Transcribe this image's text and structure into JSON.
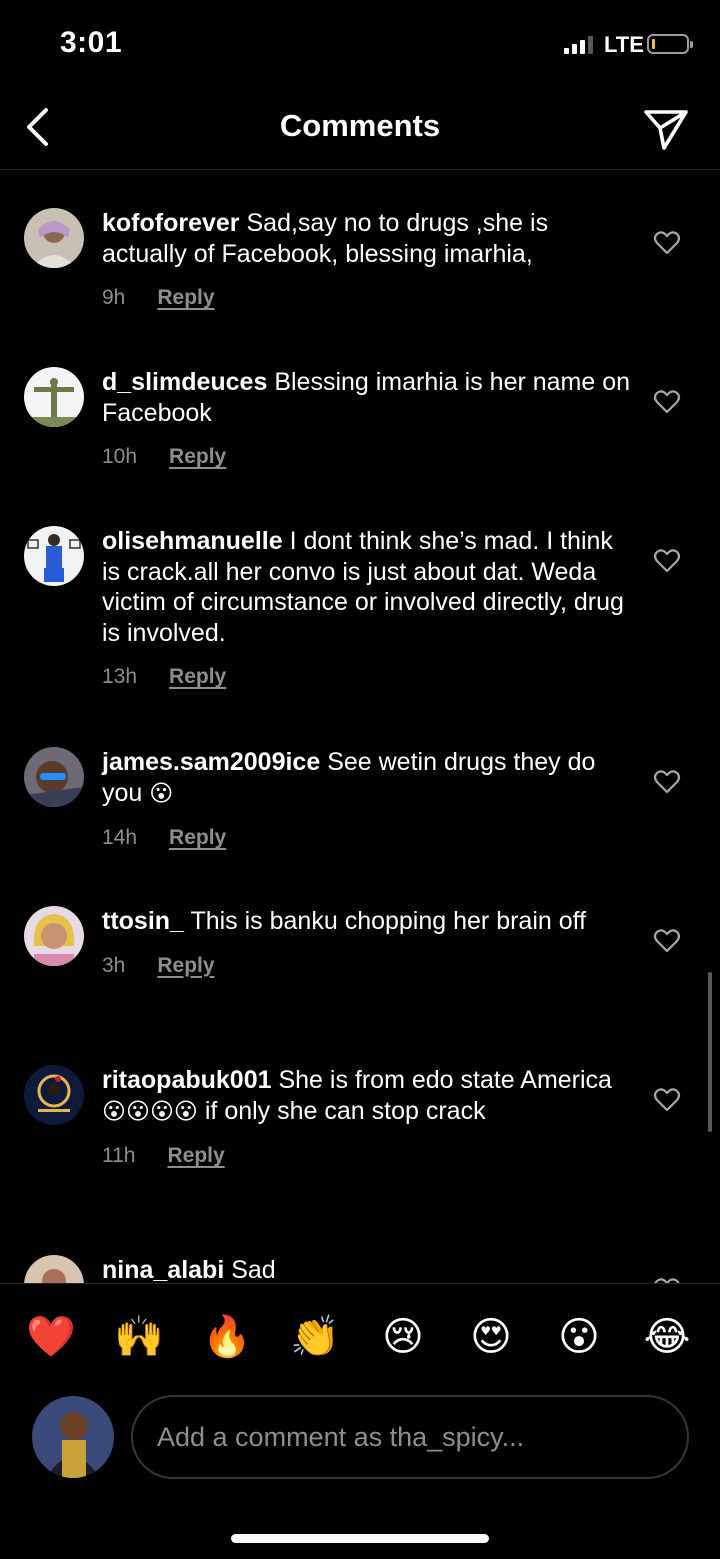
{
  "status_bar": {
    "time": "3:01",
    "network": "LTE",
    "battery_level": 0.1
  },
  "header": {
    "title": "Comments",
    "back_icon": "chevron-left-icon",
    "send_icon": "paper-plane-icon"
  },
  "comments": [
    {
      "username": "kofoforever",
      "text": "Sad,say no to drugs ,she is actually of Facebook, blessing imarhia,",
      "emojis": "",
      "time": "9h",
      "reply": "Reply"
    },
    {
      "username": "d_slimdeuces",
      "text": "Blessing imarhia is her name on Facebook",
      "emojis": "",
      "time": "10h",
      "reply": "Reply"
    },
    {
      "username": "olisehmanuelle",
      "text": "I dont think she’s mad. I think is crack.all her convo is just about dat. Weda victim of circumstance or involved directly, drug is involved.",
      "emojis": "",
      "time": "13h",
      "reply": "Reply"
    },
    {
      "username": "james.sam2009ice",
      "text": "See wetin drugs they do you",
      "emojis": "😮",
      "time": "14h",
      "reply": "Reply"
    },
    {
      "username": "ttosin_",
      "text": "This is banku chopping her brain off",
      "emojis": "",
      "time": "3h",
      "reply": "Reply"
    },
    {
      "username": "ritaopabuk001",
      "text": "She is from edo state America",
      "emojis": "😮😮😮😮",
      "text_after": "if only she can stop crack",
      "time": "11h",
      "reply": "Reply"
    },
    {
      "username": "nina_alabi",
      "text": "Sad",
      "emojis": "",
      "time": "",
      "reply": ""
    }
  ],
  "reactions": [
    "❤️",
    "🙌",
    "🔥",
    "👏",
    "😢",
    "😍",
    "😮",
    "😂"
  ],
  "composer": {
    "placeholder": "Add a comment as tha_spicy..."
  },
  "colors": {
    "background": "#000000",
    "muted_text": "#8e8e8e",
    "divider": "#262626"
  }
}
